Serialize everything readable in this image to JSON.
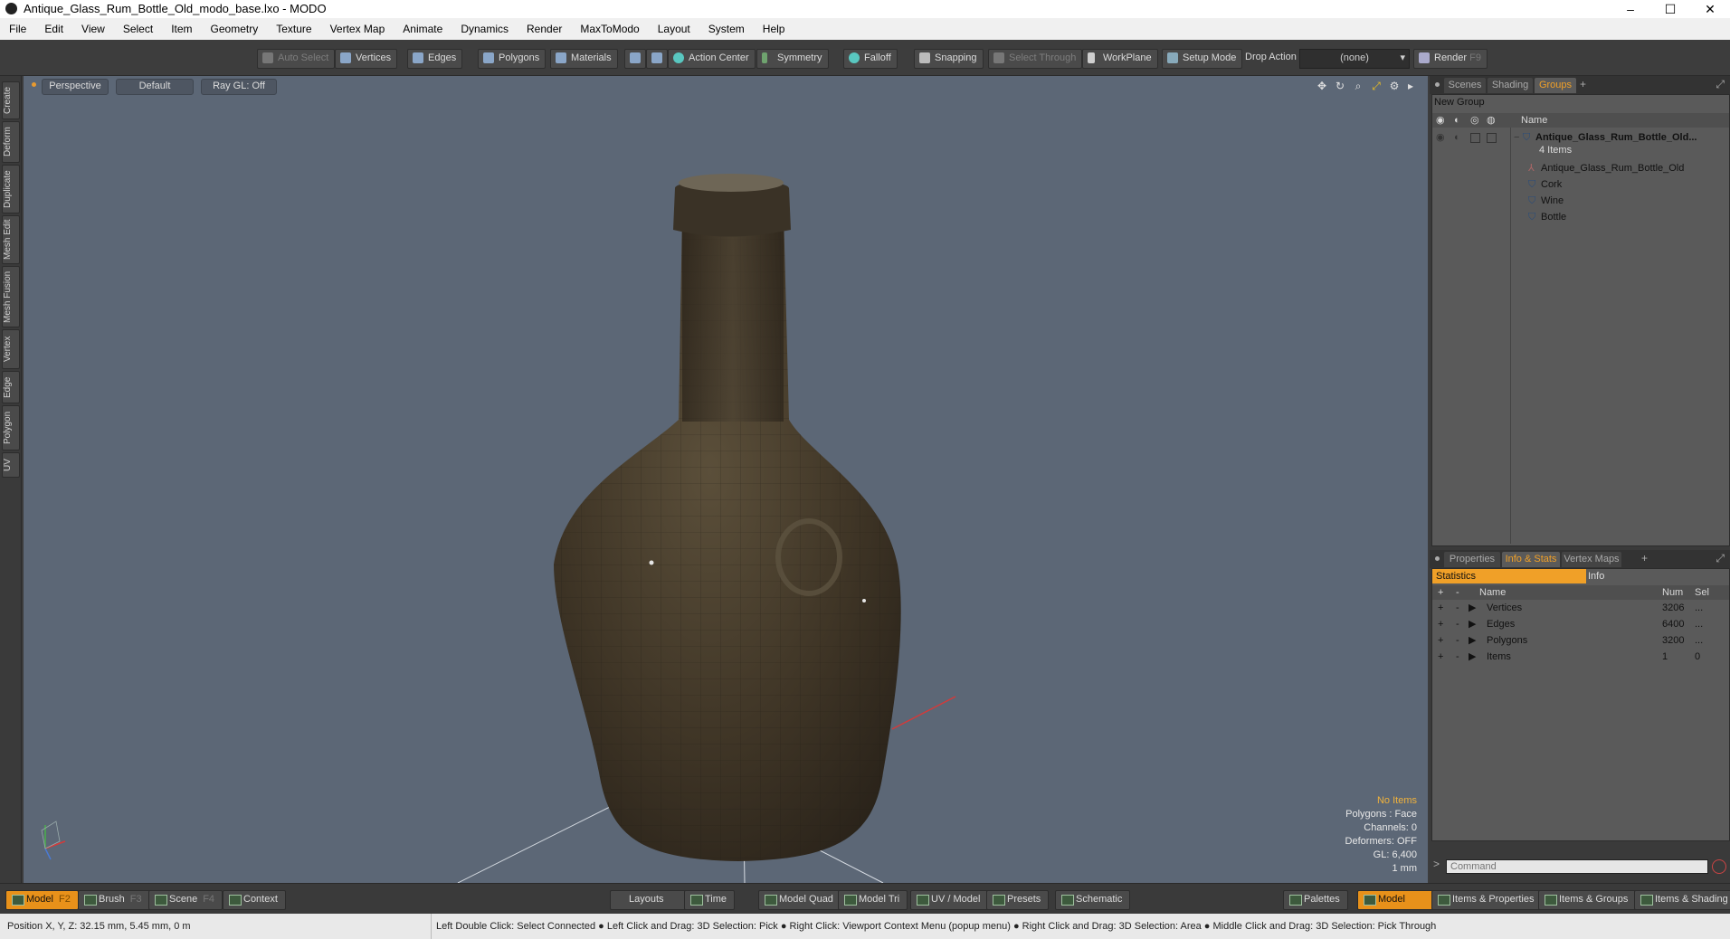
{
  "window": {
    "title": "Antique_Glass_Rum_Bottle_Old_modo_base.lxo - MODO",
    "minimize": "–",
    "maximize": "☐",
    "close": "✕"
  },
  "menu": [
    "File",
    "Edit",
    "View",
    "Select",
    "Item",
    "Geometry",
    "Texture",
    "Vertex Map",
    "Animate",
    "Dynamics",
    "Render",
    "MaxToModo",
    "Layout",
    "System",
    "Help"
  ],
  "toolbar": {
    "auto_select": "Auto Select",
    "vertices": "Vertices",
    "edges": "Edges",
    "polygons": "Polygons",
    "materials": "Materials",
    "action_center": "Action Center",
    "symmetry": "Symmetry",
    "falloff": "Falloff",
    "snapping": "Snapping",
    "select_through": "Select Through",
    "workplane": "WorkPlane",
    "setup_mode": "Setup Mode",
    "drop_action": "Drop Action",
    "drop_value": "(none)",
    "render": "Render",
    "render_key": "F9"
  },
  "left_tabs": [
    "Create",
    "Deform",
    "Duplicate",
    "Mesh Edit",
    "Mesh Fusion",
    "Vertex",
    "Edge",
    "Polygon",
    "UV"
  ],
  "viewport": {
    "view": "Perspective",
    "shading": "Default",
    "raygl": "Ray GL: Off",
    "stats": {
      "items": "No Items",
      "polygons": "Polygons : Face",
      "channels": "Channels: 0",
      "deformers": "Deformers: OFF",
      "gl": "GL: 6,400",
      "scale": "1 mm"
    }
  },
  "scene_panel": {
    "tabs": [
      "Scenes",
      "Shading",
      "Groups"
    ],
    "new_group": "New Group",
    "name_header": "Name",
    "group_name": "Antique_Glass_Rum_Bottle_Old...",
    "group_count": "4 Items",
    "children": [
      "Antique_Glass_Rum_Bottle_Old",
      "Cork",
      "Wine",
      "Bottle"
    ]
  },
  "info_panel": {
    "tabs": [
      "Properties",
      "Info & Stats",
      "Vertex Maps"
    ],
    "subtabs": [
      "Statistics",
      "Info"
    ],
    "columns": [
      "Name",
      "Num",
      "Sel"
    ],
    "rows": [
      {
        "name": "Vertices",
        "num": "3206",
        "sel": "..."
      },
      {
        "name": "Edges",
        "num": "6400",
        "sel": "..."
      },
      {
        "name": "Polygons",
        "num": "3200",
        "sel": "..."
      },
      {
        "name": "Items",
        "num": "1",
        "sel": "0"
      }
    ],
    "command_placeholder": "Command"
  },
  "bottom": {
    "model": "Model",
    "model_key": "F2",
    "brush": "Brush",
    "brush_key": "F3",
    "scene": "Scene",
    "scene_key": "F4",
    "context": "Context",
    "layouts": "Layouts",
    "time": "Time",
    "model_quad": "Model Quad",
    "model_tri": "Model Tri",
    "uv_model": "UV / Model",
    "presets": "Presets",
    "schematic": "Schematic",
    "palettes": "Palettes",
    "model2": "Model",
    "items_props": "Items & Properties",
    "items_groups": "Items & Groups",
    "items_shading": "Items & Shading"
  },
  "status": {
    "position": "Position X, Y, Z:   32.15 mm, 5.45 mm, 0 m",
    "hint": "Left Double Click: Select Connected ● Left Click and Drag: 3D Selection: Pick ● Right Click: Viewport Context Menu (popup menu) ● Right Click and Drag: 3D Selection: Area ● Middle Click and Drag: 3D Selection: Pick Through"
  }
}
